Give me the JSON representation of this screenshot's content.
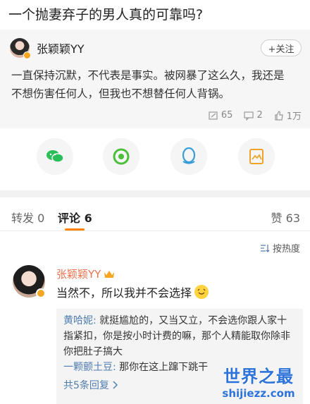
{
  "page_title": "一个抛妻弃子的男人真的可靠吗?",
  "post": {
    "username": "张颖颖YY",
    "follow_label": "+关注",
    "text": "一直保持沉默，不代表是事实。被网暴了这么久，我还是不想伤害任何人，但我也不想替任何人背锅。",
    "repost_count": "65",
    "comment_count": "2",
    "like_count": "1万"
  },
  "share": {
    "items": [
      "wechat-icon",
      "moments-icon",
      "qq-icon",
      "save-image-icon"
    ]
  },
  "tabs": {
    "repost": "转发 0",
    "comment": "评论 6",
    "like": "赞 63"
  },
  "sort_label": "按热度",
  "comment": {
    "username": "张颖颖YY",
    "text": "当然不，所以我并不会选择",
    "replies": [
      {
        "user": "黄哈妮:",
        "text": " 就挺尴尬的，又当又立，不会选你跟人家十指紧扣，你是按小时计费的嘛，那个人精能取你除非你把肚子搞大"
      },
      {
        "user": "一颗颤土豆:",
        "text": " 那你在这上蹿下跳干"
      }
    ],
    "more_replies": "共5条回复"
  },
  "watermark": {
    "top": "世界之最",
    "bottom": "shijiezz.com"
  },
  "colors": {
    "accent": "#ff8200",
    "name_orange": "#eb7350",
    "link_blue": "#507daf"
  }
}
